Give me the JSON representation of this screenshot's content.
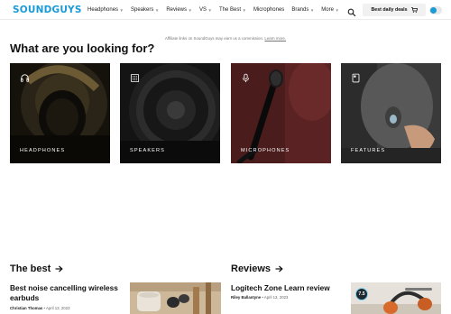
{
  "nav": {
    "logo": "SOUNDGUYS",
    "items": [
      {
        "label": "Headphones",
        "has_dropdown": true
      },
      {
        "label": "Speakers",
        "has_dropdown": true
      },
      {
        "label": "Reviews",
        "has_dropdown": true
      },
      {
        "label": "VS",
        "has_dropdown": true
      },
      {
        "label": "The Best",
        "has_dropdown": true
      },
      {
        "label": "Microphones",
        "has_dropdown": false
      },
      {
        "label": "Brands",
        "has_dropdown": true
      },
      {
        "label": "More",
        "has_dropdown": true
      }
    ],
    "search_icon": "search-icon",
    "deals_label": "Best daily deals",
    "deals_icon": "cart-icon",
    "theme_toggle_icon": "theme-toggle-icon"
  },
  "affiliate": {
    "text": "Affiliate links on SoundGuys may earn us a commission.",
    "link": "Learn more."
  },
  "categories": {
    "title": "What are you looking for?",
    "cards": [
      {
        "label": "HEADPHONES",
        "icon": "headphones-icon"
      },
      {
        "label": "SPEAKERS",
        "icon": "speaker-icon"
      },
      {
        "label": "MICROPHONES",
        "icon": "microphone-icon"
      },
      {
        "label": "FEATURES",
        "icon": "features-icon"
      }
    ]
  },
  "the_best": {
    "title": "The best",
    "article": {
      "title": "Best noise cancelling wireless earbuds",
      "author": "Christian Thomas",
      "date": "April 13, 2023"
    }
  },
  "reviews": {
    "title": "Reviews",
    "article": {
      "title": "Logitech Zone Learn review",
      "author": "Riley Ballantyne",
      "date": "April 13, 2023",
      "score": "7.5"
    }
  },
  "colors": {
    "brand": "#1a9ad6",
    "text": "#111111",
    "card_bg": "#0c0c0c"
  }
}
